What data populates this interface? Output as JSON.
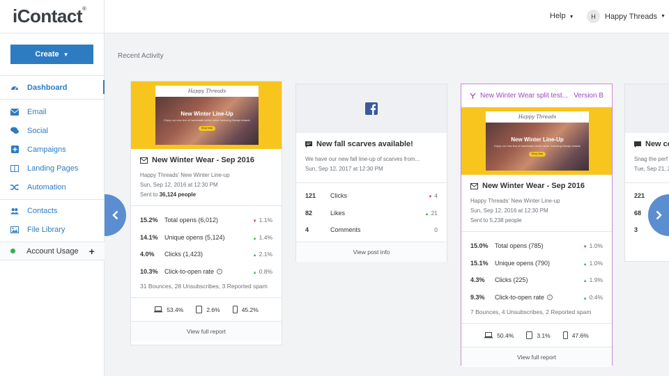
{
  "brand": {
    "logo": "iContact",
    "trademark": "®"
  },
  "topbar": {
    "help_label": "Help",
    "user_initial": "H",
    "user_name": "Happy Threads"
  },
  "sidebar": {
    "create_label": "Create",
    "items": [
      {
        "label": "Dashboard",
        "icon": "dashboard-icon"
      },
      {
        "label": "Email",
        "icon": "envelope-icon"
      },
      {
        "label": "Social",
        "icon": "chat-bubbles-icon"
      },
      {
        "label": "Campaigns",
        "icon": "plus-square-icon"
      },
      {
        "label": "Landing Pages",
        "icon": "columns-icon"
      },
      {
        "label": "Automation",
        "icon": "shuffle-icon"
      },
      {
        "label": "Contacts",
        "icon": "users-icon"
      },
      {
        "label": "File Library",
        "icon": "image-icon"
      }
    ],
    "account_label": "Account Usage",
    "account_status_color": "#2fb24a"
  },
  "main": {
    "section_title": "Recent Activity"
  },
  "cards": [
    {
      "type": "email",
      "mock_brand": "Happy Threads",
      "mock_headline": "New Winter Line-Up",
      "mock_sub": "Enjoy our new line of handmade winter wear, including Navajo shawls",
      "mock_button": "Shop Now",
      "title": "New Winter Wear - Sep 2016",
      "subject": "Happy Threads' New Winter Line-up",
      "date": "Sun, Sep 12, 2016 at 12:30 PM",
      "sent_prefix": "Sent to ",
      "sent_count": "36,124 people",
      "stats": [
        {
          "value": "15.2%",
          "label": "Total opens (6,012)",
          "dir": "down",
          "change": "1.1%"
        },
        {
          "value": "14.1%",
          "label": "Unique opens (5,124)",
          "dir": "up",
          "change": "1.4%"
        },
        {
          "value": "4.0%",
          "label": "Clicks (1,423)",
          "dir": "up",
          "change": "2.1%"
        },
        {
          "value": "10.3%",
          "label": "Click-to-open rate",
          "dir": "up",
          "change": "0.8%"
        }
      ],
      "bounces": "31 Bounces, 28 Unsubscribes, 3 Reported spam",
      "devices": {
        "desktop": "53.4%",
        "tablet": "2.6%",
        "mobile": "45.2%"
      },
      "report_label": "View full report"
    },
    {
      "type": "facebook",
      "title": "New fall scarves available!",
      "excerpt": "We have our new fall line-up of scarves from...",
      "date": "Sun, Sep 12, 2017 at 12:30 PM",
      "stats": [
        {
          "value": "121",
          "label": "Clicks",
          "dir": "down",
          "change": "4"
        },
        {
          "value": "82",
          "label": "Likes",
          "dir": "up",
          "change": "21"
        },
        {
          "value": "4",
          "label": "Comments",
          "dir": "none",
          "change": "0"
        }
      ],
      "report_label": "View post info"
    },
    {
      "type": "split",
      "split_title": "New Winter Wear split test...",
      "version": "Version B",
      "mock_brand": "Happy Threads",
      "mock_headline": "New Winter Line-Up",
      "mock_sub": "Enjoy our new line of handmade winter wear, including Navajo shawls",
      "mock_button": "Shop Now",
      "title": "New Winter Wear - Sep 2016",
      "subject": "Happy Threads' New Winter Line-up",
      "date": "Sun, Sep 12, 2016 at 12:30 PM",
      "sent": "Sent to 5,238 people",
      "stats": [
        {
          "value": "15.0%",
          "label": "Total opens (785)",
          "dir": "down",
          "change": "1.0%"
        },
        {
          "value": "15.1%",
          "label": "Unique opens (790)",
          "dir": "up",
          "change": "1.0%"
        },
        {
          "value": "4.3%",
          "label": "Clicks (225)",
          "dir": "up",
          "change": "1.9%"
        },
        {
          "value": "9.3%",
          "label": "Click-to-open rate",
          "dir": "up",
          "change": "0.4%"
        }
      ],
      "bounces": "7 Bounces, 4 Unsubscribes, 2 Reported spam",
      "devices": {
        "desktop": "50.4%",
        "tablet": "3.1%",
        "mobile": "47.6%"
      },
      "report_label": "View full report",
      "accent": "#a044c0"
    },
    {
      "type": "partial",
      "title": "New co",
      "excerpt": "Snag the perf",
      "date": "Tue, Sep 21, 2",
      "stats": [
        {
          "value": "221"
        },
        {
          "value": "68"
        },
        {
          "value": "3"
        }
      ]
    }
  ],
  "colors": {
    "primary": "#2d7cc1",
    "up": "#2fb24a",
    "down": "#d0314a",
    "hero_yellow": "#f7c51e"
  }
}
